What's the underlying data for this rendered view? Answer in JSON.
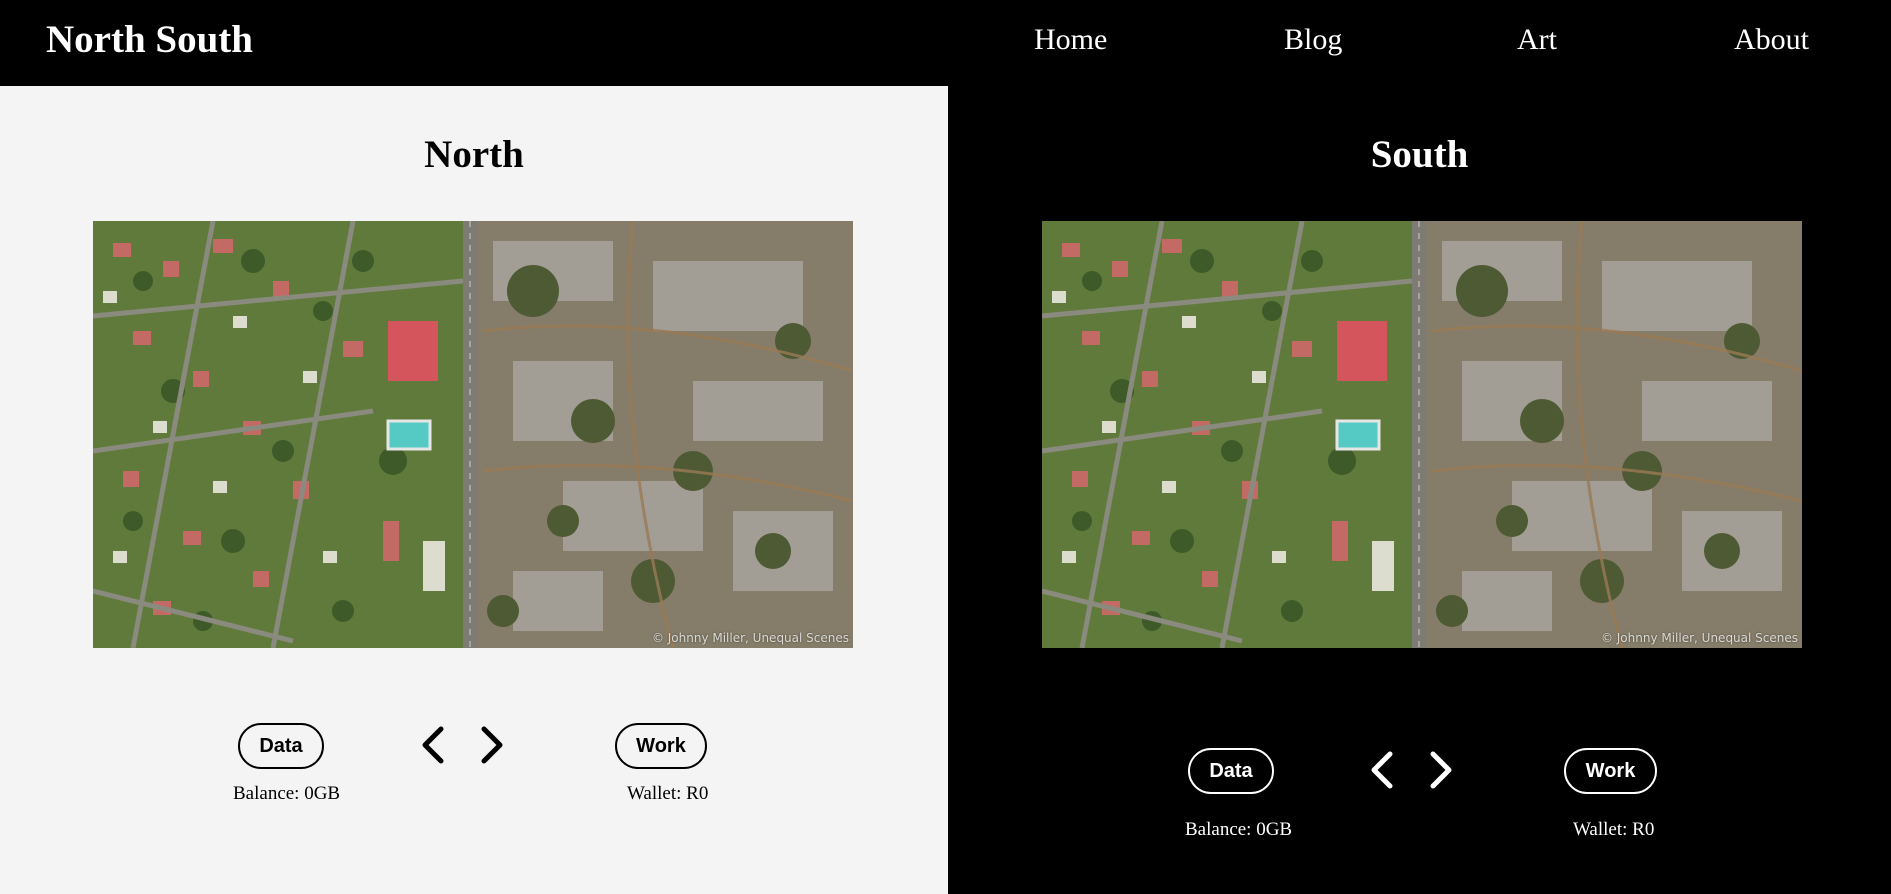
{
  "header": {
    "brand": "North South",
    "nav": [
      "Home",
      "Blog",
      "Art",
      "About"
    ]
  },
  "panels": {
    "north": {
      "title": "North",
      "photo_credit": "© Johnny Miller, Unequal Scenes",
      "data_button": "Data",
      "work_button": "Work",
      "balance": "Balance: 0GB",
      "wallet": "Wallet: R0",
      "prev_icon": "chevron-left-icon",
      "next_icon": "chevron-right-icon"
    },
    "south": {
      "title": "South",
      "photo_credit": "© Johnny Miller, Unequal Scenes",
      "data_button": "Data",
      "work_button": "Work",
      "balance": "Balance: 0GB",
      "wallet": "Wallet: R0",
      "prev_icon": "chevron-left-icon",
      "next_icon": "chevron-right-icon"
    }
  },
  "colors": {
    "north_background": "#f4f4f4",
    "south_background": "#000000",
    "header_background": "#000000"
  }
}
